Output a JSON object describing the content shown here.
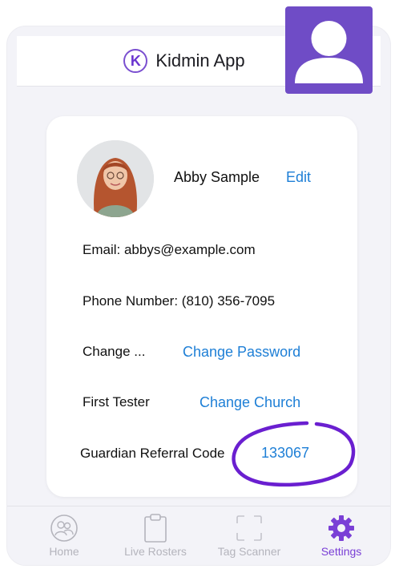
{
  "header": {
    "logo_letter": "K",
    "title": "Kidmin App"
  },
  "profile": {
    "name": "Abby Sample",
    "edit_label": "Edit",
    "email_line": "Email: abbys@example.com",
    "phone_line": "Phone Number: (810) 356-7095",
    "change_label": "Change ...",
    "change_password_label": "Change Password",
    "church_name": "First Tester",
    "change_church_label": "Change Church",
    "referral_label": "Guardian Referral Code",
    "referral_code": "133067"
  },
  "tabs": [
    {
      "label": "Home",
      "icon": "people-circle-icon",
      "active": false
    },
    {
      "label": "Live Rosters",
      "icon": "clipboard-icon",
      "active": false
    },
    {
      "label": "Tag Scanner",
      "icon": "scan-frame-icon",
      "active": false
    },
    {
      "label": "Settings",
      "icon": "gear-icon",
      "active": true
    }
  ],
  "colors": {
    "accent": "#7a3fd6",
    "link": "#1e7fd6",
    "avatar_placeholder": "#6f4cc6",
    "annotation_circle": "#6a1fd0"
  }
}
